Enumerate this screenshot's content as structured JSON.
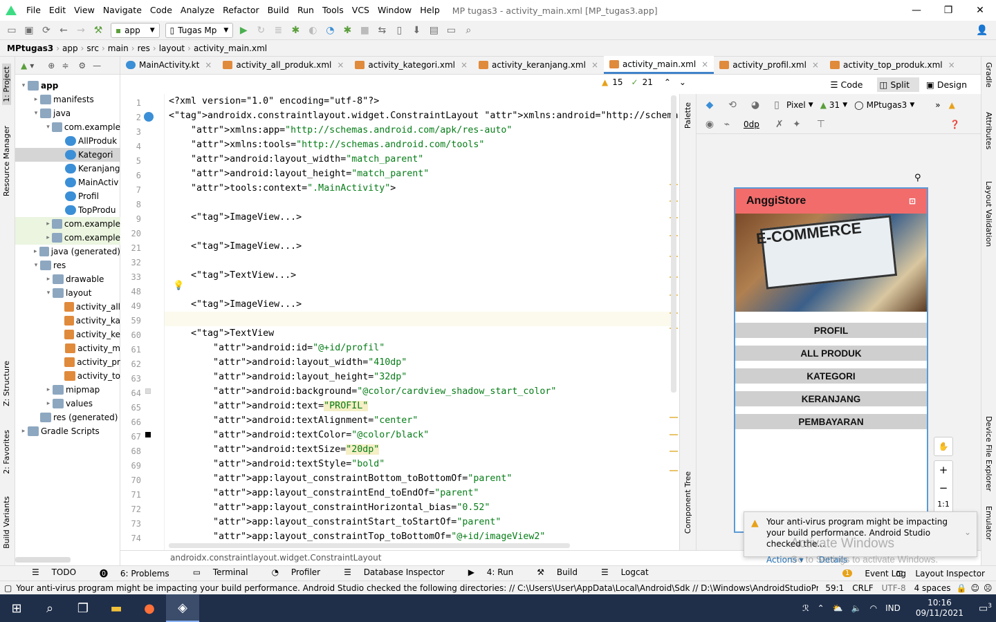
{
  "menu": {
    "items": [
      "File",
      "Edit",
      "View",
      "Navigate",
      "Code",
      "Analyze",
      "Refactor",
      "Build",
      "Run",
      "Tools",
      "VCS",
      "Window",
      "Help"
    ],
    "title": "MP tugas3 - activity_main.xml [MP_tugas3.app]"
  },
  "toolbar": {
    "module": "app",
    "device": "Tugas Mp"
  },
  "breadcrumb": [
    "MPtugas3",
    "app",
    "src",
    "main",
    "res",
    "layout",
    "activity_main.xml"
  ],
  "left_tabs": {
    "project": "1: Project",
    "resource": "Resource Manager",
    "structure": "Z: Structure",
    "favorites": "2: Favorites",
    "variants": "Build Variants"
  },
  "right_tabs": {
    "gradle": "Gradle",
    "attributes": "Attributes",
    "layout_validation": "Layout Validation",
    "device_explorer": "Device File Explorer",
    "emulator": "Emulator"
  },
  "tree": [
    {
      "label": "app",
      "depth": 0,
      "arrow": "▾",
      "icon": "fold"
    },
    {
      "label": "manifests",
      "depth": 1,
      "arrow": "▸",
      "icon": "fold"
    },
    {
      "label": "java",
      "depth": 1,
      "arrow": "▾",
      "icon": "fold"
    },
    {
      "label": "com.example",
      "depth": 2,
      "arrow": "▾",
      "icon": "fold"
    },
    {
      "label": "AllProduk",
      "depth": 3,
      "arrow": "",
      "icon": "kt"
    },
    {
      "label": "Kategori",
      "depth": 3,
      "arrow": "",
      "icon": "kt",
      "sel": true
    },
    {
      "label": "Keranjang",
      "depth": 3,
      "arrow": "",
      "icon": "kt"
    },
    {
      "label": "MainActiv",
      "depth": 3,
      "arrow": "",
      "icon": "kt"
    },
    {
      "label": "Profil",
      "depth": 3,
      "arrow": "",
      "icon": "kt"
    },
    {
      "label": "TopProdu",
      "depth": 3,
      "arrow": "",
      "icon": "kt"
    },
    {
      "label": "com.example",
      "depth": 2,
      "arrow": "▸",
      "icon": "fold",
      "mod": true
    },
    {
      "label": "com.example",
      "depth": 2,
      "arrow": "▸",
      "icon": "fold",
      "mod": true
    },
    {
      "label": "java (generated)",
      "depth": 1,
      "arrow": "▸",
      "icon": "fold"
    },
    {
      "label": "res",
      "depth": 1,
      "arrow": "▾",
      "icon": "fold"
    },
    {
      "label": "drawable",
      "depth": 2,
      "arrow": "▸",
      "icon": "fold"
    },
    {
      "label": "layout",
      "depth": 2,
      "arrow": "▾",
      "icon": "fold"
    },
    {
      "label": "activity_all",
      "depth": 3,
      "arrow": "",
      "icon": "xmlic"
    },
    {
      "label": "activity_ka",
      "depth": 3,
      "arrow": "",
      "icon": "xmlic"
    },
    {
      "label": "activity_ke",
      "depth": 3,
      "arrow": "",
      "icon": "xmlic"
    },
    {
      "label": "activity_m",
      "depth": 3,
      "arrow": "",
      "icon": "xmlic"
    },
    {
      "label": "activity_pr",
      "depth": 3,
      "arrow": "",
      "icon": "xmlic"
    },
    {
      "label": "activity_to",
      "depth": 3,
      "arrow": "",
      "icon": "xmlic"
    },
    {
      "label": "mipmap",
      "depth": 2,
      "arrow": "▸",
      "icon": "fold"
    },
    {
      "label": "values",
      "depth": 2,
      "arrow": "▸",
      "icon": "fold"
    },
    {
      "label": "res (generated)",
      "depth": 1,
      "arrow": "",
      "icon": "fold"
    },
    {
      "label": "Gradle Scripts",
      "depth": 0,
      "arrow": "▸",
      "icon": "fold"
    }
  ],
  "tabs": [
    {
      "label": "MainActivity.kt",
      "kt": true
    },
    {
      "label": "activity_all_produk.xml"
    },
    {
      "label": "activity_kategori.xml"
    },
    {
      "label": "activity_keranjang.xml"
    },
    {
      "label": "activity_main.xml",
      "active": true
    },
    {
      "label": "activity_profil.xml"
    },
    {
      "label": "activity_top_produk.xml"
    }
  ],
  "inspections": {
    "warnings": "15",
    "weak": "21"
  },
  "code": [
    {
      "n": "1",
      "t": "<?xml version=\"1.0\" encoding=\"utf-8\"?>"
    },
    {
      "n": "2",
      "t": "<androidx.constraintlayout.widget.ConstraintLayout xmlns:android=\"http://schemas.android.com"
    },
    {
      "n": "3",
      "t": "    xmlns:app=\"http://schemas.android.com/apk/res-auto\""
    },
    {
      "n": "4",
      "t": "    xmlns:tools=\"http://schemas.android.com/tools\""
    },
    {
      "n": "5",
      "t": "    android:layout_width=\"match_parent\""
    },
    {
      "n": "6",
      "t": "    android:layout_height=\"match_parent\""
    },
    {
      "n": "7",
      "t": "    tools:context=\".MainActivity\">"
    },
    {
      "n": "8",
      "t": ""
    },
    {
      "n": "9",
      "t": "    <ImageView...>"
    },
    {
      "n": "20",
      "t": ""
    },
    {
      "n": "21",
      "t": "    <ImageView...>"
    },
    {
      "n": "32",
      "t": ""
    },
    {
      "n": "33",
      "t": "    <TextView...>"
    },
    {
      "n": "48",
      "t": ""
    },
    {
      "n": "49",
      "t": "    <ImageView...>"
    },
    {
      "n": "59",
      "t": ""
    },
    {
      "n": "60",
      "t": "    <TextView"
    },
    {
      "n": "61",
      "t": "        android:id=\"@+id/profil\""
    },
    {
      "n": "62",
      "t": "        android:layout_width=\"410dp\""
    },
    {
      "n": "63",
      "t": "        android:layout_height=\"32dp\""
    },
    {
      "n": "64",
      "t": "        android:background=\"@color/cardview_shadow_start_color\""
    },
    {
      "n": "65",
      "t": "        android:text=\"PROFIL\""
    },
    {
      "n": "66",
      "t": "        android:textAlignment=\"center\""
    },
    {
      "n": "67",
      "t": "        android:textColor=\"@color/black\""
    },
    {
      "n": "68",
      "t": "        android:textSize=\"20dp\""
    },
    {
      "n": "69",
      "t": "        android:textStyle=\"bold\""
    },
    {
      "n": "70",
      "t": "        app:layout_constraintBottom_toBottomOf=\"parent\""
    },
    {
      "n": "71",
      "t": "        app:layout_constraintEnd_toEndOf=\"parent\""
    },
    {
      "n": "72",
      "t": "        app:layout_constraintHorizontal_bias=\"0.52\""
    },
    {
      "n": "73",
      "t": "        app:layout_constraintStart_toStartOf=\"parent\""
    },
    {
      "n": "74",
      "t": "        app:layout_constraintTop_toBottomOf=\"@+id/imageView2\""
    }
  ],
  "editor_footer": "androidx.constraintlayout.widget.ConstraintLayout",
  "view_modes": {
    "code": "Code",
    "split": "Split",
    "design": "Design"
  },
  "design_toolbar": {
    "device": "Pixel",
    "api": "31",
    "theme": "MPtugas3",
    "margin": "0dp"
  },
  "side_labels": {
    "palette": "Palette",
    "component_tree": "Component Tree"
  },
  "preview": {
    "app_title": "AnggiStore",
    "hero_text": "E-COMMERCE",
    "buttons": [
      "PROFIL",
      "ALL PRODUK",
      "KATEGORI",
      "KERANJANG",
      "PEMBAYARAN"
    ],
    "zoom": "1:1"
  },
  "notification": {
    "message": "Your anti-virus program might be impacting your build performance. Android Studio checked the...",
    "actions": "Actions",
    "details": "Details"
  },
  "watermark": {
    "line1": "Activate Windows",
    "line2": "Go to Settings to activate Windows."
  },
  "bottom_tools": [
    "TODO",
    "6: Problems",
    "Terminal",
    "Profiler",
    "Database Inspector",
    "4: Run",
    "Build",
    "Logcat"
  ],
  "bottom_right": {
    "event_log": "Event Log",
    "layout_inspector": "Layout Inspector",
    "event_count": "1"
  },
  "statusbar": {
    "message": "Your anti-virus program might be impacting your build performance. Android Studio checked the following directories: // C:\\Users\\User\\AppData\\Local\\Android\\Sdk // D:\\Windows\\AndroidStudioProje... (today 9:03)",
    "position": "59:1",
    "line_sep": "CRLF",
    "encoding": "UTF-8",
    "indent": "4 spaces"
  },
  "taskbar": {
    "lang": "IND",
    "time": "10:16",
    "date": "09/11/2021",
    "notif_count": "3"
  }
}
